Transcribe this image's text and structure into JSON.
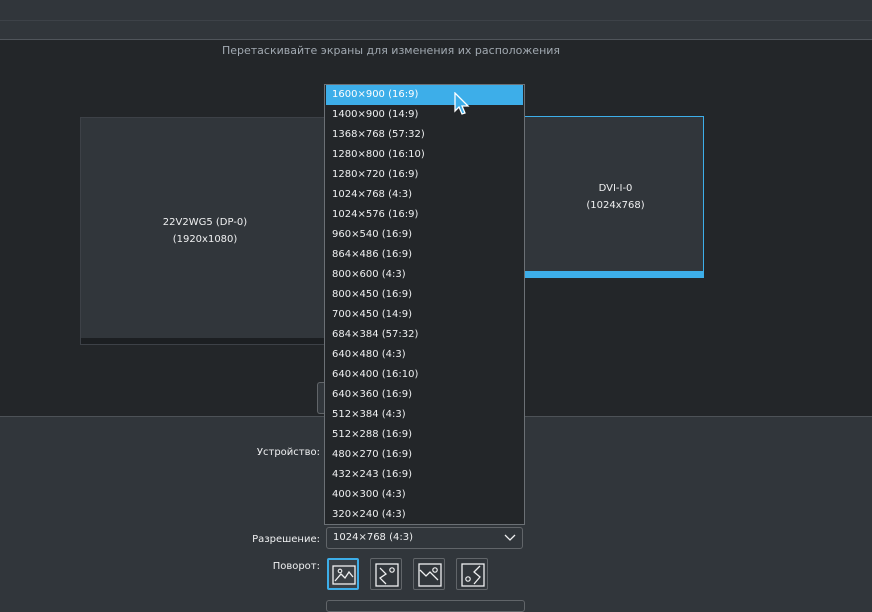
{
  "canvas": {
    "hint": "Перетаскивайте экраны для изменения их расположения"
  },
  "screens": [
    {
      "name": "22V2WG5 (DP-0)",
      "resolution": "(1920x1080)"
    },
    {
      "name": "DVI-I-0",
      "resolution": "(1024x768)"
    }
  ],
  "form": {
    "device_label": "Устройство:",
    "resolution_label": "Разрешение:",
    "resolution_value": "1024×768 (4:3)",
    "rotation_label": "Поворот:"
  },
  "rotation_options": [
    "landscape-icon",
    "rotate-left-icon",
    "rotate-inverted-icon",
    "rotate-right-icon"
  ],
  "dropdown": {
    "highlighted_index": 0,
    "options": [
      "1600×900 (16:9)",
      "1400×900 (14:9)",
      "1368×768 (57:32)",
      "1280×800 (16:10)",
      "1280×720 (16:9)",
      "1024×768 (4:3)",
      "1024×576 (16:9)",
      "960×540 (16:9)",
      "864×486 (16:9)",
      "800×600 (4:3)",
      "800×450 (16:9)",
      "700×450 (14:9)",
      "684×384 (57:32)",
      "640×480 (4:3)",
      "640×400 (16:10)",
      "640×360 (16:9)",
      "512×384 (4:3)",
      "512×288 (16:9)",
      "480×270 (16:9)",
      "432×243 (16:9)",
      "400×300 (4:3)",
      "320×240 (4:3)"
    ]
  },
  "colors": {
    "accent": "#3daee9",
    "background": "#31363b",
    "canvas": "#232629"
  }
}
